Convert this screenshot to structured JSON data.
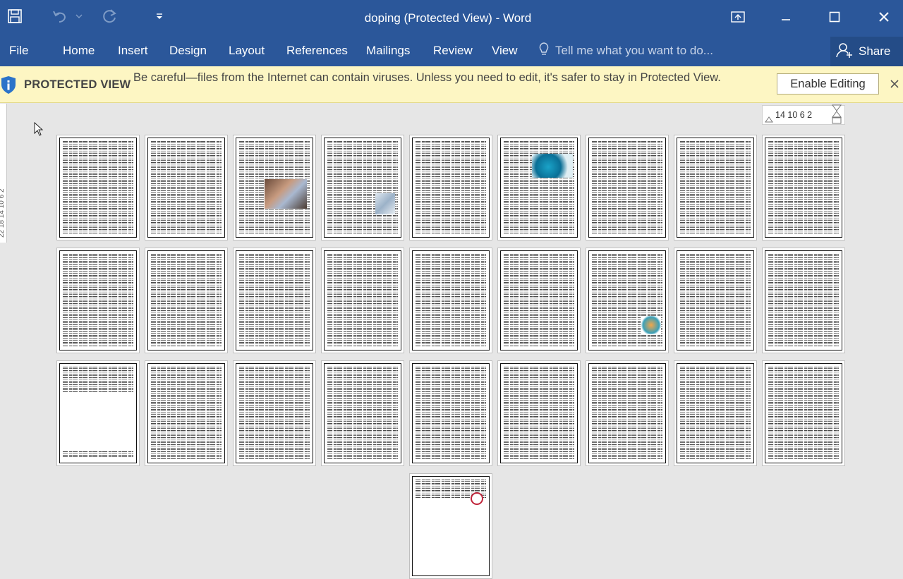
{
  "app": {
    "title": "doping (Protected View) - Word"
  },
  "qat": {
    "save": "save-icon",
    "undo": "undo-icon",
    "redo": "redo-icon",
    "customize": "chevron-down-icon"
  },
  "ribbon": {
    "file": "File",
    "tabs": [
      "Home",
      "Insert",
      "Design",
      "Layout",
      "References",
      "Mailings",
      "Review",
      "View"
    ],
    "tell_me": "Tell me what you want to do...",
    "share": "Share"
  },
  "protected_view": {
    "label": "PROTECTED VIEW",
    "message": "Be careful—files from the Internet can contain viruses. Unless you need to edit, it's safer to stay in Protected View.",
    "enable_button": "Enable Editing"
  },
  "rulers": {
    "horizontal": "14  10   6    2",
    "vertical": "22 18 14 10  6  2"
  },
  "colors": {
    "title_bar": "#2b579a",
    "protected_bar": "#fdf6c3",
    "workspace": "#e6e6e6"
  },
  "document": {
    "page_count": 28
  }
}
